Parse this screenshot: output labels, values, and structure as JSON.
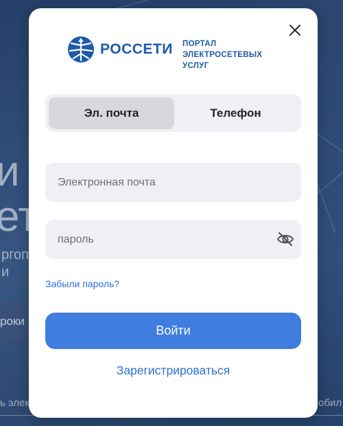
{
  "background": {
    "big_line1": "и",
    "big_line2": "ет",
    "small_line1": "ргоп",
    "small_line2": "и",
    "chip_text": "роки",
    "bottom_left": "ь элек",
    "bottom_right": "обил"
  },
  "logo": {
    "brand": "РОССЕТИ",
    "portal_line1": "ПОРТАЛ",
    "portal_line2": "ЭЛЕКТРОСЕТЕВЫХ УСЛУГ"
  },
  "tabs": [
    {
      "label": "Эл. почта",
      "active": true
    },
    {
      "label": "Телефон",
      "active": false
    }
  ],
  "form": {
    "email": {
      "placeholder": "Электронная почта",
      "value": ""
    },
    "password": {
      "placeholder": "пароль",
      "value": ""
    },
    "forgot_label": "Забыли пароль?",
    "submit_label": "Войти",
    "register_label": "Зарегистрироваться"
  },
  "colors": {
    "brand_blue": "#1d5aa8",
    "button_blue": "#3f7de0",
    "link_blue": "#2f6fd6"
  },
  "icons": {
    "close": "close-icon",
    "password_toggle": "eye-off-icon",
    "logo": "rosseti-logo-icon"
  }
}
